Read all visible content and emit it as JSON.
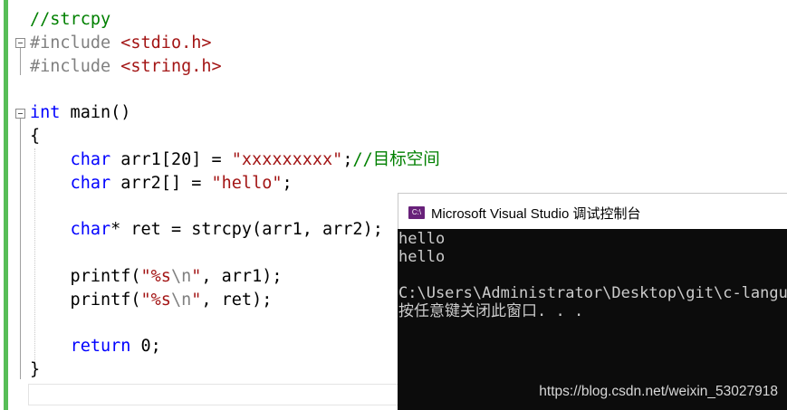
{
  "editor": {
    "lines": [
      [
        {
          "t": "//strcpy",
          "c": "comment"
        }
      ],
      [
        {
          "t": "#include ",
          "c": "pre"
        },
        {
          "t": "<stdio.h>",
          "c": "inc"
        }
      ],
      [
        {
          "t": "#include ",
          "c": "pre"
        },
        {
          "t": "<string.h>",
          "c": "inc"
        }
      ],
      [],
      [
        {
          "t": "int",
          "c": "kw"
        },
        {
          "t": " main()"
        }
      ],
      [
        {
          "t": "{"
        }
      ],
      [
        {
          "t": "    "
        },
        {
          "t": "char",
          "c": "kw"
        },
        {
          "t": " arr1[20] = "
        },
        {
          "t": "\"xxxxxxxxx\"",
          "c": "str"
        },
        {
          "t": ";"
        },
        {
          "t": "//目标空间",
          "c": "comment"
        }
      ],
      [
        {
          "t": "    "
        },
        {
          "t": "char",
          "c": "kw"
        },
        {
          "t": " arr2[] = "
        },
        {
          "t": "\"hello\"",
          "c": "str"
        },
        {
          "t": ";"
        }
      ],
      [],
      [
        {
          "t": "    "
        },
        {
          "t": "char",
          "c": "kw"
        },
        {
          "t": "* ret = strcpy(arr1, arr2);"
        }
      ],
      [],
      [
        {
          "t": "    printf("
        },
        {
          "t": "\"%s",
          "c": "str"
        },
        {
          "t": "\\n",
          "c": "esc"
        },
        {
          "t": "\"",
          "c": "str"
        },
        {
          "t": ", arr1);"
        }
      ],
      [
        {
          "t": "    printf("
        },
        {
          "t": "\"%s",
          "c": "str"
        },
        {
          "t": "\\n",
          "c": "esc"
        },
        {
          "t": "\"",
          "c": "str"
        },
        {
          "t": ", ret);"
        }
      ],
      [],
      [
        {
          "t": "    "
        },
        {
          "t": "return",
          "c": "kw"
        },
        {
          "t": " 0;"
        }
      ],
      [
        {
          "t": "}"
        }
      ]
    ]
  },
  "console": {
    "title": "Microsoft Visual Studio 调试控制台",
    "icon_label": "C:\\",
    "output": "hello\nhello\n\nC:\\Users\\Administrator\\Desktop\\git\\c-language\n按任意键关闭此窗口. . ."
  },
  "watermark": "https://blog.csdn.net/weixin_53027918"
}
